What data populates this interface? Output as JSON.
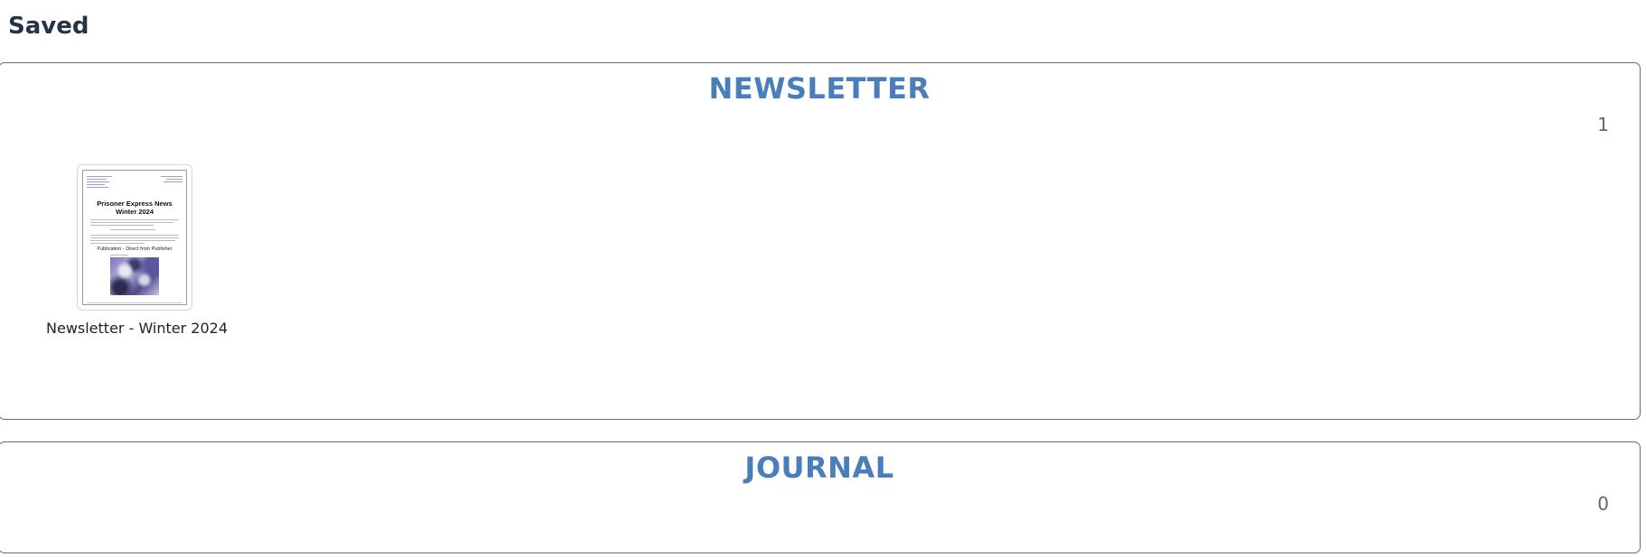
{
  "page": {
    "title": "Saved"
  },
  "sections": [
    {
      "title": "NEWSLETTER",
      "count": "1",
      "items": [
        {
          "label": "Newsletter - Winter 2024",
          "thumbnail": {
            "heading_line1": "Prisoner Express News",
            "heading_line2": "Winter 2024",
            "subheading": "Publication  -  Direct from Publisher"
          }
        }
      ]
    },
    {
      "title": "JOURNAL",
      "count": "0",
      "items": []
    }
  ],
  "colors": {
    "section_title": "#4a7ebb",
    "page_title": "#243447",
    "border": "#6b6b6b"
  }
}
